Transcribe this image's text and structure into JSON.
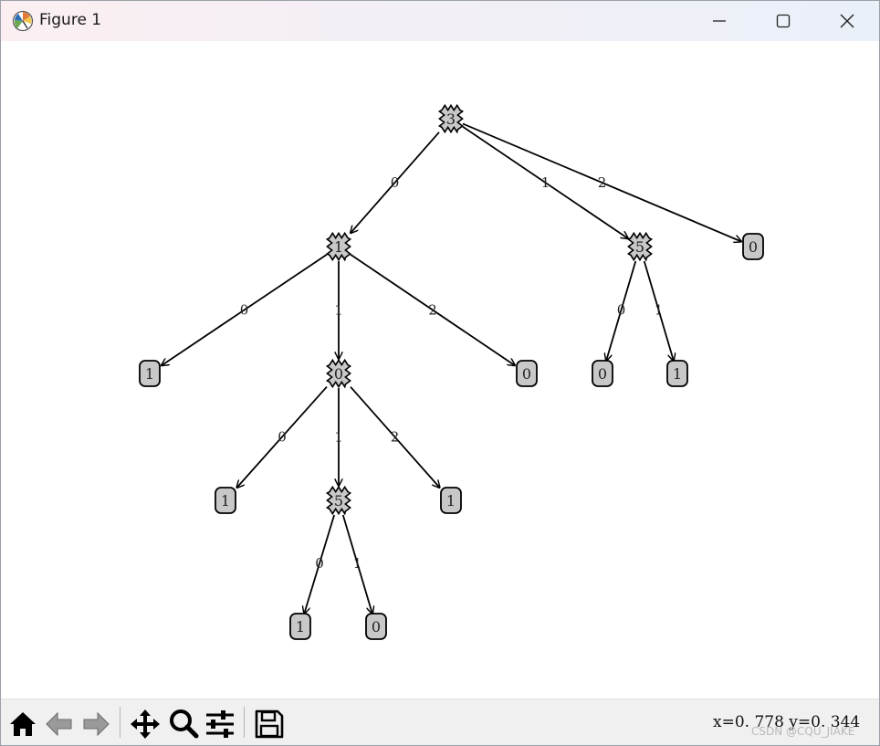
{
  "window": {
    "title": "Figure 1",
    "buttons": {
      "minimize": "minimize",
      "maximize": "maximize",
      "close": "close"
    }
  },
  "tree": {
    "nodes": [
      {
        "id": "n_root",
        "label": "3",
        "kind": "decision"
      },
      {
        "id": "n_a",
        "label": "1",
        "kind": "decision"
      },
      {
        "id": "n_b",
        "label": "5",
        "kind": "decision"
      },
      {
        "id": "n_c",
        "label": "0",
        "kind": "leaf"
      },
      {
        "id": "n_a0",
        "label": "1",
        "kind": "leaf"
      },
      {
        "id": "n_a1",
        "label": "0",
        "kind": "decision"
      },
      {
        "id": "n_a2",
        "label": "0",
        "kind": "leaf"
      },
      {
        "id": "n_b0",
        "label": "0",
        "kind": "leaf"
      },
      {
        "id": "n_b1",
        "label": "1",
        "kind": "leaf"
      },
      {
        "id": "n_a1_0",
        "label": "1",
        "kind": "leaf"
      },
      {
        "id": "n_a1_1",
        "label": "5",
        "kind": "decision"
      },
      {
        "id": "n_a1_2",
        "label": "1",
        "kind": "leaf"
      },
      {
        "id": "n_a1_1_0",
        "label": "1",
        "kind": "leaf"
      },
      {
        "id": "n_a1_1_1",
        "label": "0",
        "kind": "leaf"
      }
    ],
    "edges": [
      {
        "from": "n_root",
        "to": "n_a",
        "label": "0"
      },
      {
        "from": "n_root",
        "to": "n_b",
        "label": "1"
      },
      {
        "from": "n_root",
        "to": "n_c",
        "label": "2"
      },
      {
        "from": "n_a",
        "to": "n_a0",
        "label": "0"
      },
      {
        "from": "n_a",
        "to": "n_a1",
        "label": "1"
      },
      {
        "from": "n_a",
        "to": "n_a2",
        "label": "2"
      },
      {
        "from": "n_b",
        "to": "n_b0",
        "label": "0"
      },
      {
        "from": "n_b",
        "to": "n_b1",
        "label": "1"
      },
      {
        "from": "n_a1",
        "to": "n_a1_0",
        "label": "0"
      },
      {
        "from": "n_a1",
        "to": "n_a1_1",
        "label": "1"
      },
      {
        "from": "n_a1",
        "to": "n_a1_2",
        "label": "2"
      },
      {
        "from": "n_a1_1",
        "to": "n_a1_1_0",
        "label": "0"
      },
      {
        "from": "n_a1_1",
        "to": "n_a1_1_1",
        "label": "1"
      }
    ],
    "colors": {
      "node_fill": "#c8c8c8",
      "stroke": "#000000"
    }
  },
  "toolbar": {
    "tools": [
      "home-icon",
      "back-arrow-icon",
      "forward-arrow-icon",
      "pan-move-icon",
      "zoom-magnifier-icon",
      "configure-subplots-icon",
      "save-floppy-icon"
    ],
    "coordinates": "x=0. 778  y=0. 344"
  },
  "watermark": "CSDN @CQU_JIAKE"
}
